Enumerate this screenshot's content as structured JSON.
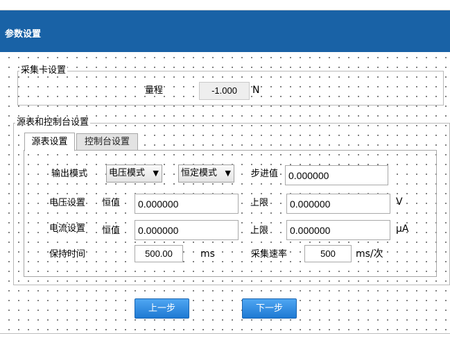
{
  "window": {
    "title": "参数设置"
  },
  "acquisition": {
    "group_label": "采集卡设置",
    "range_label": "量程",
    "range_value": "-1.000",
    "range_unit": "N"
  },
  "source": {
    "group_label": "源表和控制台设置",
    "tabs": [
      {
        "label": "源表设置",
        "active": true
      },
      {
        "label": "控制台设置",
        "active": false
      }
    ],
    "output_mode_label": "输出模式",
    "output_mode_value": "电压模式",
    "fixed_mode_value": "恒定模式",
    "step_label": "步进值",
    "step_value": "0.000000",
    "voltage_label": "电压设置",
    "voltage_const_label": "恒值",
    "voltage_const_value": "0.000000",
    "voltage_limit_label": "上限",
    "voltage_limit_value": "0.000000",
    "voltage_unit": "V",
    "current_label": "电流设置",
    "current_const_label": "恒值",
    "current_const_value": "0.000000",
    "current_limit_label": "上限",
    "current_limit_value": "0.000000",
    "current_unit": "μA",
    "hold_label": "保持时间",
    "hold_value": "500.00",
    "hold_unit": "ms",
    "rate_label": "采集速率",
    "rate_value": "500",
    "rate_unit": "ms/次"
  },
  "buttons": {
    "prev": "上一步",
    "next": "下一步"
  },
  "colors": {
    "titlebar": "#1962a6",
    "button": "#2b86dc"
  }
}
